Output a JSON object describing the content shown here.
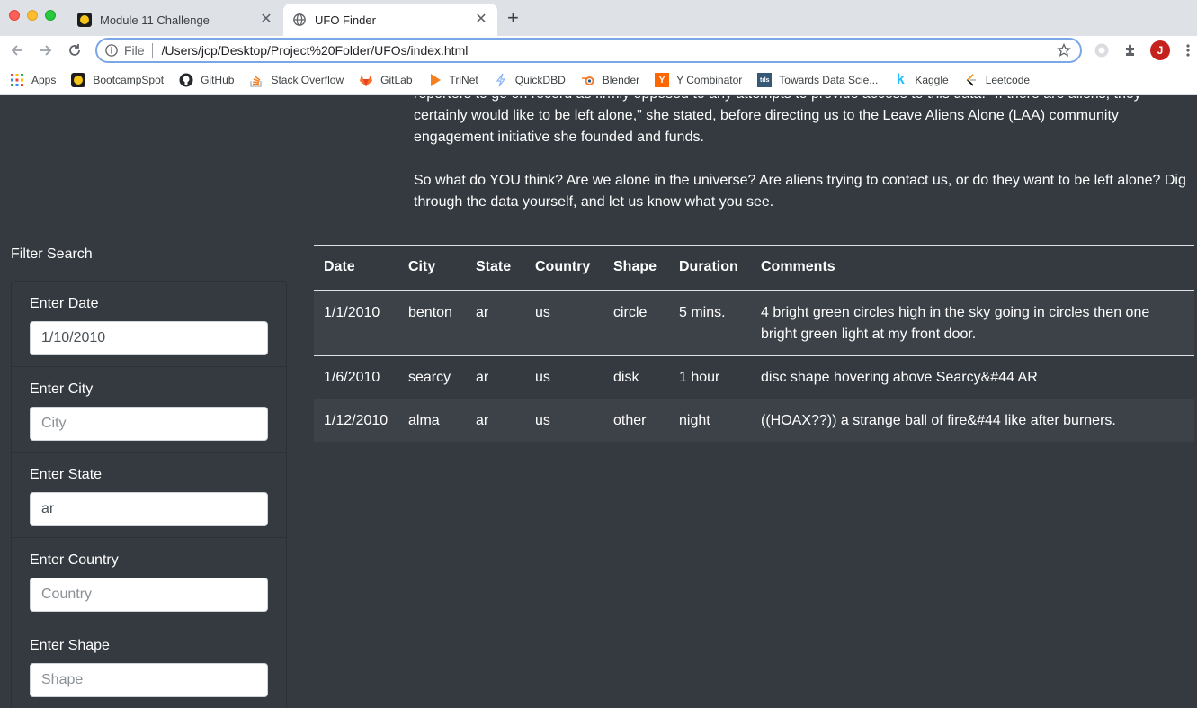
{
  "browser": {
    "tabs": [
      {
        "title": "Module 11 Challenge",
        "active": false,
        "favicon": "bootcamp-logo-icon"
      },
      {
        "title": "UFO Finder",
        "active": true,
        "favicon": "globe-icon"
      }
    ],
    "address": {
      "scheme": "File",
      "url": "/Users/jcp/Desktop/Project%20Folder/UFOs/index.html"
    },
    "profile_initial": "J",
    "bookmarks": [
      {
        "label": "Apps",
        "icon": "apps-grid-icon"
      },
      {
        "label": "BootcampSpot",
        "icon": "bootcamp-logo-icon"
      },
      {
        "label": "GitHub",
        "icon": "github-icon"
      },
      {
        "label": "Stack Overflow",
        "icon": "stackoverflow-icon"
      },
      {
        "label": "GitLab",
        "icon": "gitlab-icon"
      },
      {
        "label": "TriNet",
        "icon": "trinet-icon"
      },
      {
        "label": "QuickDBD",
        "icon": "quickdbd-icon"
      },
      {
        "label": "Blender",
        "icon": "blender-icon"
      },
      {
        "label": "Y Combinator",
        "icon": "ycombinator-icon"
      },
      {
        "label": "Towards Data Scie...",
        "icon": "tds-icon"
      },
      {
        "label": "Kaggle",
        "icon": "kaggle-icon"
      },
      {
        "label": "Leetcode",
        "icon": "leetcode-icon"
      }
    ]
  },
  "article": {
    "paragraph1_lines": [
      "reporters to go on record as firmly opposed to any attempts to provide access to this data. \"If there are aliens, they",
      "certainly would like to be left alone,\" she stated, before directing us to the Leave Aliens Alone (LAA) community",
      "engagement initiative she founded and funds."
    ],
    "paragraph2": "So what do YOU think? Are we alone in the universe? Are aliens trying to contact us, or do they want to be left alone? Dig through the data yourself, and let us know what you see."
  },
  "filters": {
    "title": "Filter Search",
    "items": [
      {
        "label": "Enter Date",
        "value": "1/10/2010",
        "placeholder": ""
      },
      {
        "label": "Enter City",
        "value": "",
        "placeholder": "City"
      },
      {
        "label": "Enter State",
        "value": "ar",
        "placeholder": ""
      },
      {
        "label": "Enter Country",
        "value": "",
        "placeholder": "Country"
      },
      {
        "label": "Enter Shape",
        "value": "",
        "placeholder": "Shape"
      }
    ]
  },
  "table": {
    "headers": [
      "Date",
      "City",
      "State",
      "Country",
      "Shape",
      "Duration",
      "Comments"
    ],
    "rows": [
      [
        "1/1/2010",
        "benton",
        "ar",
        "us",
        "circle",
        "5 mins.",
        "4 bright green circles high in the sky going in circles then one bright green light at my front door."
      ],
      [
        "1/6/2010",
        "searcy",
        "ar",
        "us",
        "disk",
        "1 hour",
        "disc shape hovering above Searcy&#44 AR"
      ],
      [
        "1/12/2010",
        "alma",
        "ar",
        "us",
        "other",
        "night",
        "((HOAX??)) a strange ball of fire&#44 like after burners."
      ]
    ]
  }
}
